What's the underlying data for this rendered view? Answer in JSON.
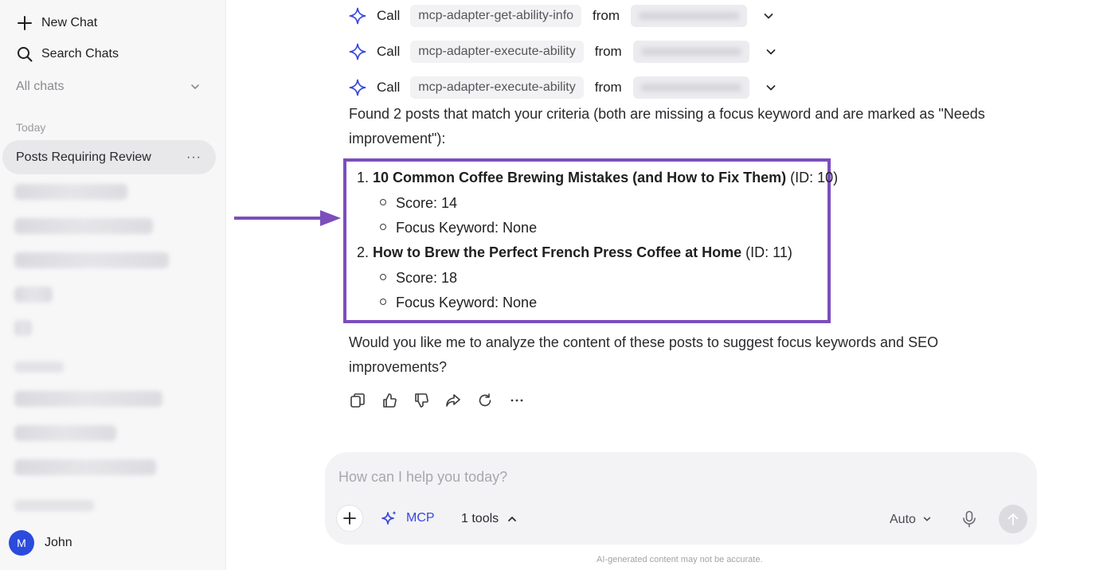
{
  "sidebar": {
    "new_chat": "New Chat",
    "search_chats": "Search Chats",
    "all_chats": "All chats",
    "today_label": "Today",
    "active_chat": "Posts Requiring Review",
    "active_chat_menu": "···",
    "user": {
      "initial": "M",
      "name": "John",
      "avatar_color": "#2b4bdc"
    }
  },
  "tool_calls": [
    {
      "call": "Call",
      "tool": "mcp-adapter-get-ability-info",
      "from": "from"
    },
    {
      "call": "Call",
      "tool": "mcp-adapter-execute-ability",
      "from": "from"
    },
    {
      "call": "Call",
      "tool": "mcp-adapter-execute-ability",
      "from": "from"
    }
  ],
  "message": {
    "intro": "Found 2 posts that match your criteria (both are missing a focus keyword and are marked as \"Needs improvement\"):",
    "posts": [
      {
        "number": "1.",
        "title": "10 Common Coffee Brewing Mistakes (and How to Fix Them)",
        "id": "(ID: 10)",
        "score": "Score: 14",
        "focus": "Focus Keyword: None"
      },
      {
        "number": "2.",
        "title": "How to Brew the Perfect French Press Coffee at Home",
        "id": "(ID: 11)",
        "score": "Score: 18",
        "focus": "Focus Keyword: None"
      }
    ],
    "followup": "Would you like me to analyze the content of these posts to suggest focus keywords and SEO improvements?"
  },
  "actions": [
    "copy-icon",
    "thumbs-up-icon",
    "thumbs-down-icon",
    "share-icon",
    "regenerate-icon",
    "more-icon"
  ],
  "composer": {
    "placeholder": "How can I help you today?",
    "mcp_label": "MCP",
    "tools_label": "1 tools",
    "model_label": "Auto"
  },
  "disclaimer": "AI-generated content may not be accurate.",
  "colors": {
    "accent": "#3847e0",
    "highlight": "#7c4dbd",
    "sidebar_bg": "#f7f7f8",
    "active_bg": "#e8e8eb"
  }
}
